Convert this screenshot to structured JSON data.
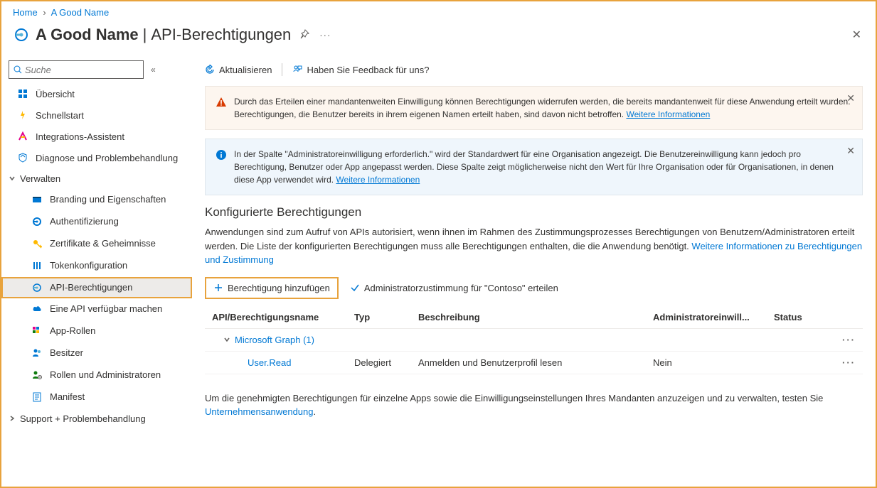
{
  "breadcrumb": {
    "home": "Home",
    "current": "A Good Name"
  },
  "header": {
    "app": "A Good Name",
    "section": "API-Berechtigungen"
  },
  "search": {
    "placeholder": "Suche"
  },
  "nav": {
    "overview": "Übersicht",
    "quickstart": "Schnellstart",
    "integration": "Integrations-Assistent",
    "diagnose": "Diagnose und Problembehandlung",
    "manage": "Verwalten",
    "branding": "Branding und Eigenschaften",
    "auth": "Authentifizierung",
    "certs": "Zertifikate & Geheimnisse",
    "token": "Tokenkonfiguration",
    "api_perms": "API-Berechtigungen",
    "expose_api": "Eine API verfügbar machen",
    "app_roles": "App-Rollen",
    "owners": "Besitzer",
    "roles_admins": "Rollen und Administratoren",
    "manifest": "Manifest",
    "support": "Support + Problembehandlung"
  },
  "toolbar": {
    "refresh": "Aktualisieren",
    "feedback": "Haben Sie Feedback für uns?"
  },
  "alerts": {
    "warn": "Durch das Erteilen einer mandantenweiten Einwilligung können Berechtigungen widerrufen werden, die bereits mandantenweit für diese Anwendung erteilt wurden. Berechtigungen, die Benutzer bereits in ihrem eigenen Namen erteilt haben, sind davon nicht betroffen. ",
    "warn_link": "Weitere Informationen",
    "info": "In der Spalte \"Administratoreinwilligung erforderlich.\" wird der Standardwert für eine Organisation angezeigt. Die Benutzereinwilligung kann jedoch pro Berechtigung, Benutzer oder App angepasst werden. Diese Spalte zeigt möglicherweise nicht den Wert für Ihre Organisation oder für Organisationen, in denen diese App verwendet wird. ",
    "info_link": "Weitere Informationen"
  },
  "config": {
    "title": "Konfigurierte Berechtigungen",
    "desc": "Anwendungen sind zum Aufruf von APIs autorisiert, wenn ihnen im Rahmen des Zustimmungsprozesses Berechtigungen von Benutzern/Administratoren erteilt werden. Die Liste der konfigurierten Berechtigungen muss alle Berechtigungen enthalten, die die Anwendung benötigt. ",
    "desc_link": "Weitere Informationen zu Berechtigungen und Zustimmung",
    "add": "Berechtigung hinzufügen",
    "grant": "Administratorzustimmung für \"Contoso\" erteilen"
  },
  "table": {
    "col1": "API/Berechtigungsname",
    "col2": "Typ",
    "col3": "Beschreibung",
    "col4": "Administratoreinwill...",
    "col5": "Status",
    "group": "Microsoft Graph (1)",
    "perm_name": "User.Read",
    "perm_type": "Delegiert",
    "perm_desc": "Anmelden und Benutzerprofil lesen",
    "perm_admin": "Nein"
  },
  "footer": {
    "text": "Um die genehmigten Berechtigungen für einzelne Apps sowie die Einwilligungseinstellungen Ihres Mandanten anzuzeigen und zu verwalten, testen Sie ",
    "link": "Unternehmensanwendung",
    "period": "."
  }
}
